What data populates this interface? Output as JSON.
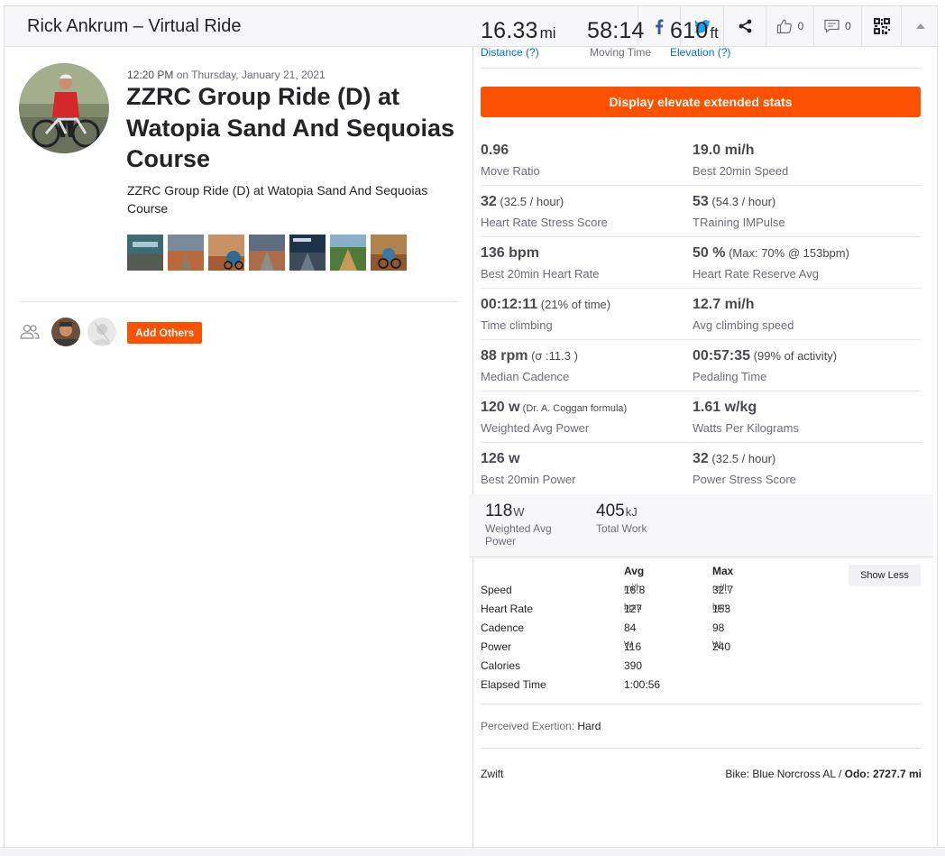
{
  "header": {
    "title": "Rick Ankrum – Virtual Ride",
    "kudos_count": "0",
    "comment_count": "0"
  },
  "activity": {
    "time": "12:20 PM",
    "date_suffix": " on Thursday, January 21, 2021",
    "title": "ZZRC Group Ride (D) at Watopia Sand And Sequoias Course",
    "description": "ZZRC Group Ride (D) at Watopia Sand And Sequoias Course",
    "add_others_label": "Add Others"
  },
  "inline_stats": [
    {
      "value": "16.33",
      "unit": "mi",
      "label": "Distance (?)"
    },
    {
      "value": "58:14",
      "unit": "",
      "label": "Moving Time"
    },
    {
      "value": "610",
      "unit": "ft",
      "label": "Elevation (?)"
    }
  ],
  "elevate_button_label": "Display elevate extended stats",
  "extended_stats": [
    {
      "left": {
        "value": "0.96",
        "extra": "",
        "label": "Move Ratio"
      },
      "right": {
        "value": "19.0 mi/h",
        "extra": "",
        "label": "Best 20min Speed"
      }
    },
    {
      "left": {
        "value": "32",
        "extra": " (32.5 / hour)",
        "label": "Heart Rate Stress Score"
      },
      "right": {
        "value": "53",
        "extra": " (54.3 / hour)",
        "label": "TRaining IMPulse"
      }
    },
    {
      "left": {
        "value": "136 bpm",
        "extra": "",
        "label": "Best 20min Heart Rate"
      },
      "right": {
        "value": "50 %",
        "extra": " (Max: 70% @ 153bpm)",
        "label": "Heart Rate Reserve Avg"
      }
    },
    {
      "left": {
        "value": "00:12:11",
        "extra": " (21% of time)",
        "label": "Time climbing"
      },
      "right": {
        "value": "12.7 mi/h",
        "extra": "",
        "label": "Avg climbing speed"
      }
    },
    {
      "left": {
        "value": "88 rpm",
        "extra": " (σ :11.3 )",
        "label": "Median Cadence"
      },
      "right": {
        "value": "00:57:35",
        "extra": " (99% of activity)",
        "label": "Pedaling Time"
      }
    },
    {
      "left": {
        "value": "120 w",
        "extra": " (Dr. A. Coggan formula)",
        "label": "Weighted Avg Power"
      },
      "right": {
        "value": "1.61 w/kg",
        "extra": "",
        "label": "Watts Per Kilograms"
      }
    },
    {
      "left": {
        "value": "126 w",
        "extra": "",
        "label": "Best 20min Power"
      },
      "right": {
        "value": "32",
        "extra": " (32.5 / hour)",
        "label": "Power Stress Score"
      }
    }
  ],
  "power_stats": [
    {
      "value": "118",
      "unit": "W",
      "label": "Weighted Avg Power"
    },
    {
      "value": "405",
      "unit": "kJ",
      "label": "Total Work"
    }
  ],
  "more_stats": {
    "headers": {
      "avg": "Avg",
      "max": "Max"
    },
    "show_less_label": "Show Less",
    "rows": [
      {
        "label": "Speed",
        "avg": "16.8",
        "avg_unit": "mi/h",
        "max": "32.7",
        "max_unit": "mi/h"
      },
      {
        "label": "Heart Rate",
        "avg": "127",
        "avg_unit": "bpm",
        "max": "153",
        "max_unit": "bpm"
      },
      {
        "label": "Cadence",
        "avg": "84",
        "avg_unit": "",
        "max": "98",
        "max_unit": ""
      },
      {
        "label": "Power",
        "avg": "116",
        "avg_unit": "W",
        "max": "240",
        "max_unit": "W"
      },
      {
        "label": "Calories",
        "avg": "390",
        "avg_unit": "",
        "max": "",
        "max_unit": ""
      },
      {
        "label": "Elapsed Time",
        "avg": "1:00:56",
        "avg_unit": "",
        "max": "",
        "max_unit": ""
      }
    ]
  },
  "perceived_exertion": {
    "label": "Perceived Exertion: ",
    "value": "Hard"
  },
  "device": "Zwift",
  "bike": {
    "label": "Bike: Blue Norcross AL / ",
    "odo_label": "Odo: 2727.7 mi"
  },
  "colors": {
    "accent": "#fc5200",
    "link": "#0073c5",
    "facebook": "#3b5998",
    "twitter": "#1da1f2"
  }
}
